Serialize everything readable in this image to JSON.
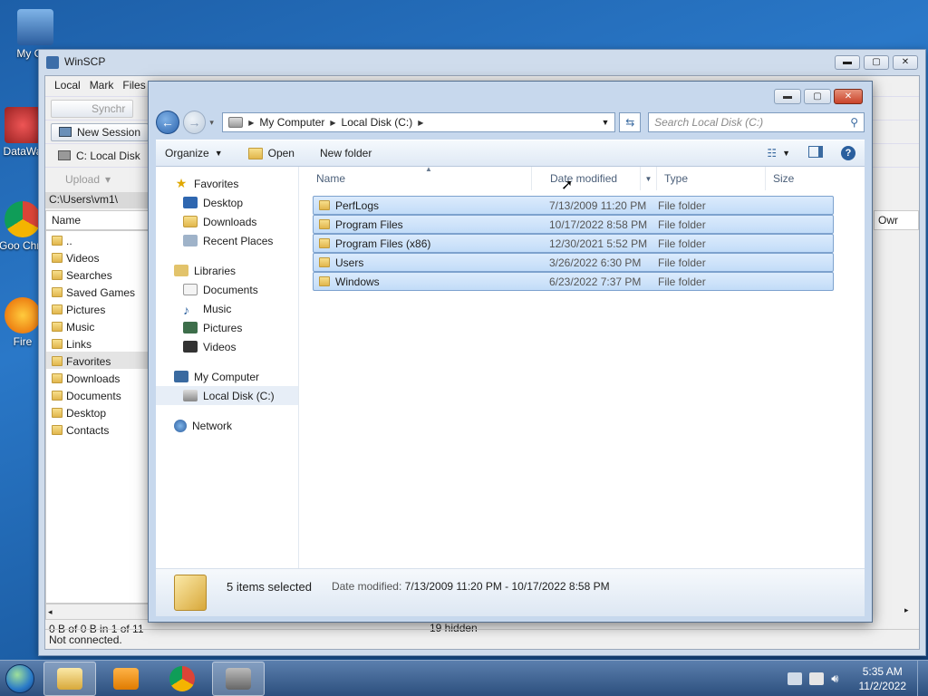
{
  "desktop": {
    "icons": [
      {
        "label": "My Computer",
        "short": "My Con"
      },
      {
        "label": "DataWarrior",
        "short": "DataWa"
      },
      {
        "label": "Google Chrome",
        "short": "Goo\nChro"
      },
      {
        "label": "Firefox",
        "short": "Fire"
      }
    ]
  },
  "winscp": {
    "title": "WinSCP",
    "menu": [
      "Local",
      "Mark",
      "Files"
    ],
    "toolbar": {
      "synchronize": "Synchr",
      "new_session": "New Session",
      "drive": "C: Local Disk",
      "upload": "Upload"
    },
    "path": "C:\\Users\\vm1\\",
    "left_panel": {
      "header": "Name",
      "items": [
        "..",
        "Videos",
        "Searches",
        "Saved Games",
        "Pictures",
        "Music",
        "Links",
        "Favorites",
        "Downloads",
        "Documents",
        "Desktop",
        "Contacts"
      ],
      "selected": "Favorites"
    },
    "right_panel": {
      "header": "Owr"
    },
    "status_left": "0 B of 0 B in 1 of 11",
    "status_right": "19 hidden",
    "connection": "Not connected."
  },
  "dialog": {
    "breadcrumb": [
      "My Computer",
      "Local Disk (C:)"
    ],
    "search_placeholder": "Search Local Disk (C:)",
    "commands": {
      "organize": "Organize",
      "open": "Open",
      "new_folder": "New folder"
    },
    "nav": {
      "favorites": {
        "label": "Favorites",
        "items": [
          "Desktop",
          "Downloads",
          "Recent Places"
        ]
      },
      "libraries": {
        "label": "Libraries",
        "items": [
          "Documents",
          "Music",
          "Pictures",
          "Videos"
        ]
      },
      "computer": {
        "label": "My Computer",
        "items": [
          "Local Disk (C:)"
        ]
      },
      "network": {
        "label": "Network"
      }
    },
    "columns": {
      "name": "Name",
      "date": "Date modified",
      "type": "Type",
      "size": "Size"
    },
    "files": [
      {
        "name": "PerfLogs",
        "date": "7/13/2009 11:20 PM",
        "type": "File folder"
      },
      {
        "name": "Program Files",
        "date": "10/17/2022 8:58 PM",
        "type": "File folder"
      },
      {
        "name": "Program Files (x86)",
        "date": "12/30/2021 5:52 PM",
        "type": "File folder"
      },
      {
        "name": "Users",
        "date": "3/26/2022 6:30 PM",
        "type": "File folder"
      },
      {
        "name": "Windows",
        "date": "6/23/2022 7:37 PM",
        "type": "File folder"
      }
    ],
    "details": {
      "count": "5 items selected",
      "label": "Date modified:",
      "value": "7/13/2009 11:20 PM - 10/17/2022 8:58 PM"
    }
  },
  "taskbar": {
    "time": "5:35 AM",
    "date": "11/2/2022"
  }
}
